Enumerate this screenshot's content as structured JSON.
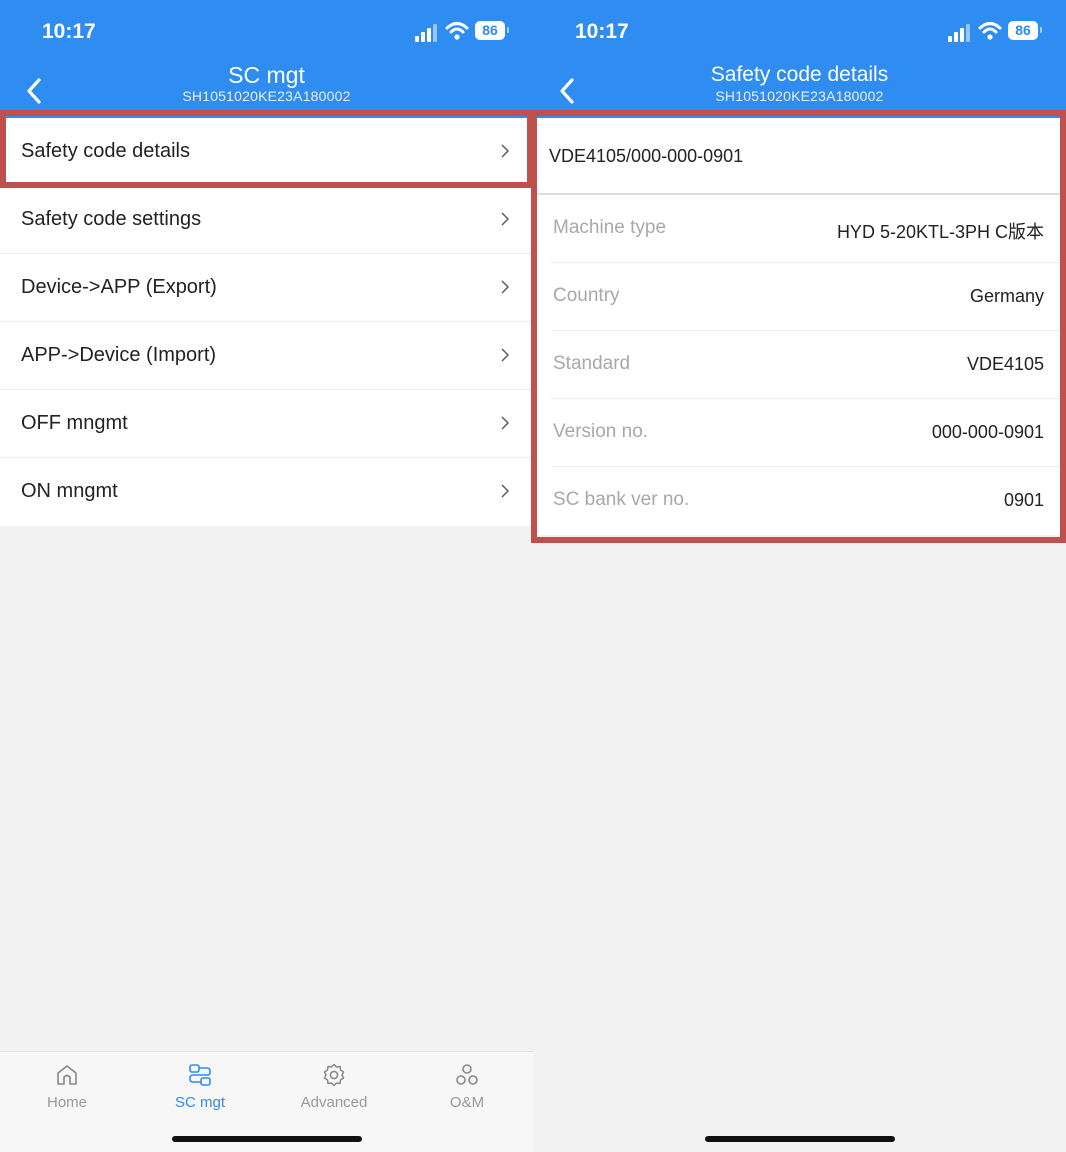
{
  "colors": {
    "header": "#2f8cf0",
    "active_tab": "#2f8cf0",
    "highlight": "#c0504d"
  },
  "left": {
    "status": {
      "time": "10:17",
      "battery": "86"
    },
    "header": {
      "title": "SC mgt",
      "serial": "SH1051020KE23A180002"
    },
    "menu": [
      {
        "label": "Safety code details"
      },
      {
        "label": "Safety code settings"
      },
      {
        "label": "Device->APP (Export)"
      },
      {
        "label": "APP->Device (Import)"
      },
      {
        "label": "OFF mngmt"
      },
      {
        "label": "ON mngmt"
      }
    ],
    "tabs": [
      {
        "label": "Home",
        "icon": "home-icon"
      },
      {
        "label": "SC mgt",
        "icon": "sc-mgt-icon",
        "active": true
      },
      {
        "label": "Advanced",
        "icon": "gear-icon"
      },
      {
        "label": "O&M",
        "icon": "om-icon"
      }
    ]
  },
  "right": {
    "status": {
      "time": "10:17",
      "battery": "86"
    },
    "header": {
      "title": "Safety code details",
      "serial": "SH1051020KE23A180002"
    },
    "code": "VDE4105/000-000-0901",
    "details": [
      {
        "label": "Machine type",
        "value": "HYD 5-20KTL-3PH C版本"
      },
      {
        "label": "Country",
        "value": "Germany"
      },
      {
        "label": "Standard",
        "value": "VDE4105"
      },
      {
        "label": "Version no.",
        "value": "000-000-0901"
      },
      {
        "label": "SC bank ver no.",
        "value": "0901"
      }
    ]
  }
}
